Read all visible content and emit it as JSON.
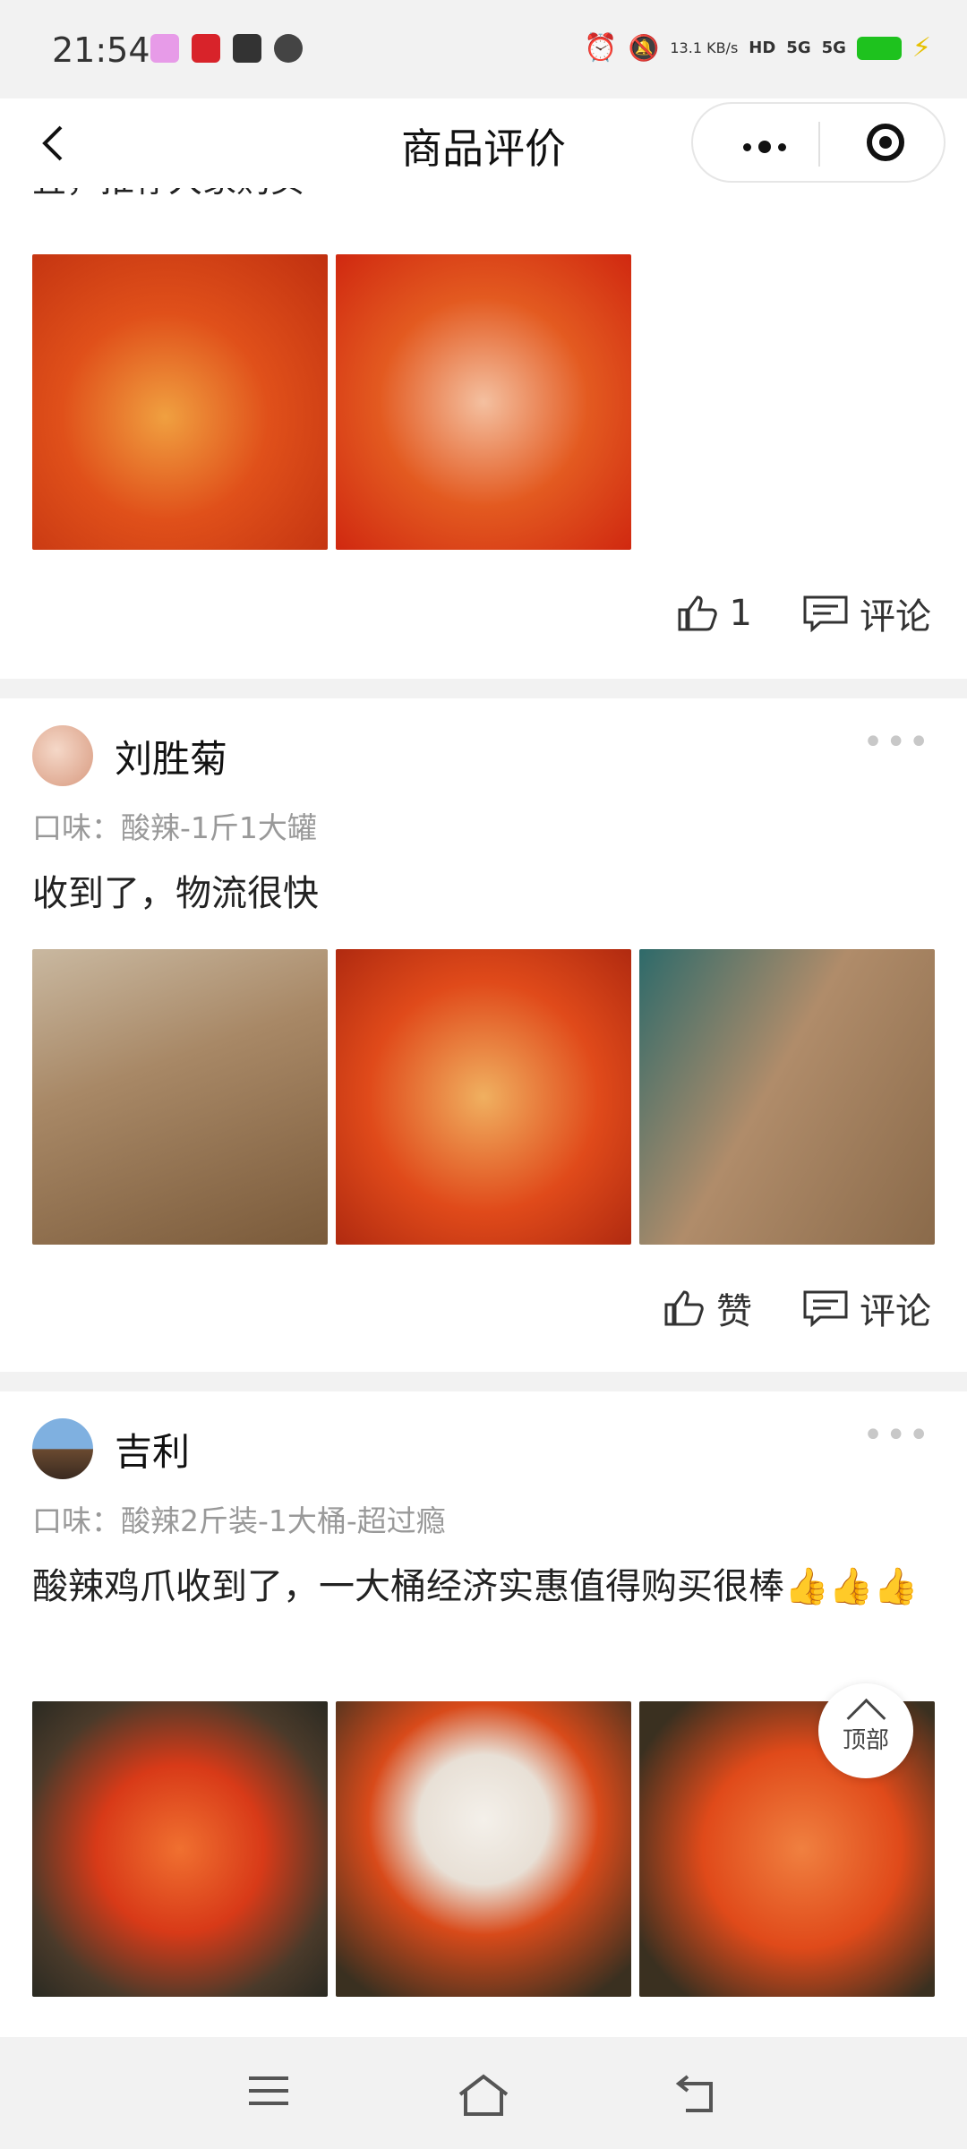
{
  "status": {
    "time": "21:54",
    "netspeed": "13.1 KB/s",
    "signal1": "5G",
    "signal2": "5G",
    "hd": "HD"
  },
  "nav": {
    "title": "商品评价"
  },
  "partial_review": {
    "text": "宜，推荐大家购买",
    "like_count": "1",
    "comment_label": "评论"
  },
  "reviews": [
    {
      "name": "刘胜菊",
      "flavor": "口味：酸辣-1斤1大罐",
      "text": "收到了，物流很快",
      "like_label": "赞",
      "comment_label": "评论"
    },
    {
      "name": "吉利",
      "flavor": "口味：酸辣2斤装-1大桶-超过瘾",
      "text": "酸辣鸡爪收到了，一大桶经济实惠值得购买很棒👍👍👍"
    }
  ],
  "top_button": {
    "label": "顶部"
  },
  "more_dots": "•••",
  "colors": {
    "accent": "#e8491d",
    "battery": "#1ec21e",
    "divider": "#f2f2f2"
  }
}
